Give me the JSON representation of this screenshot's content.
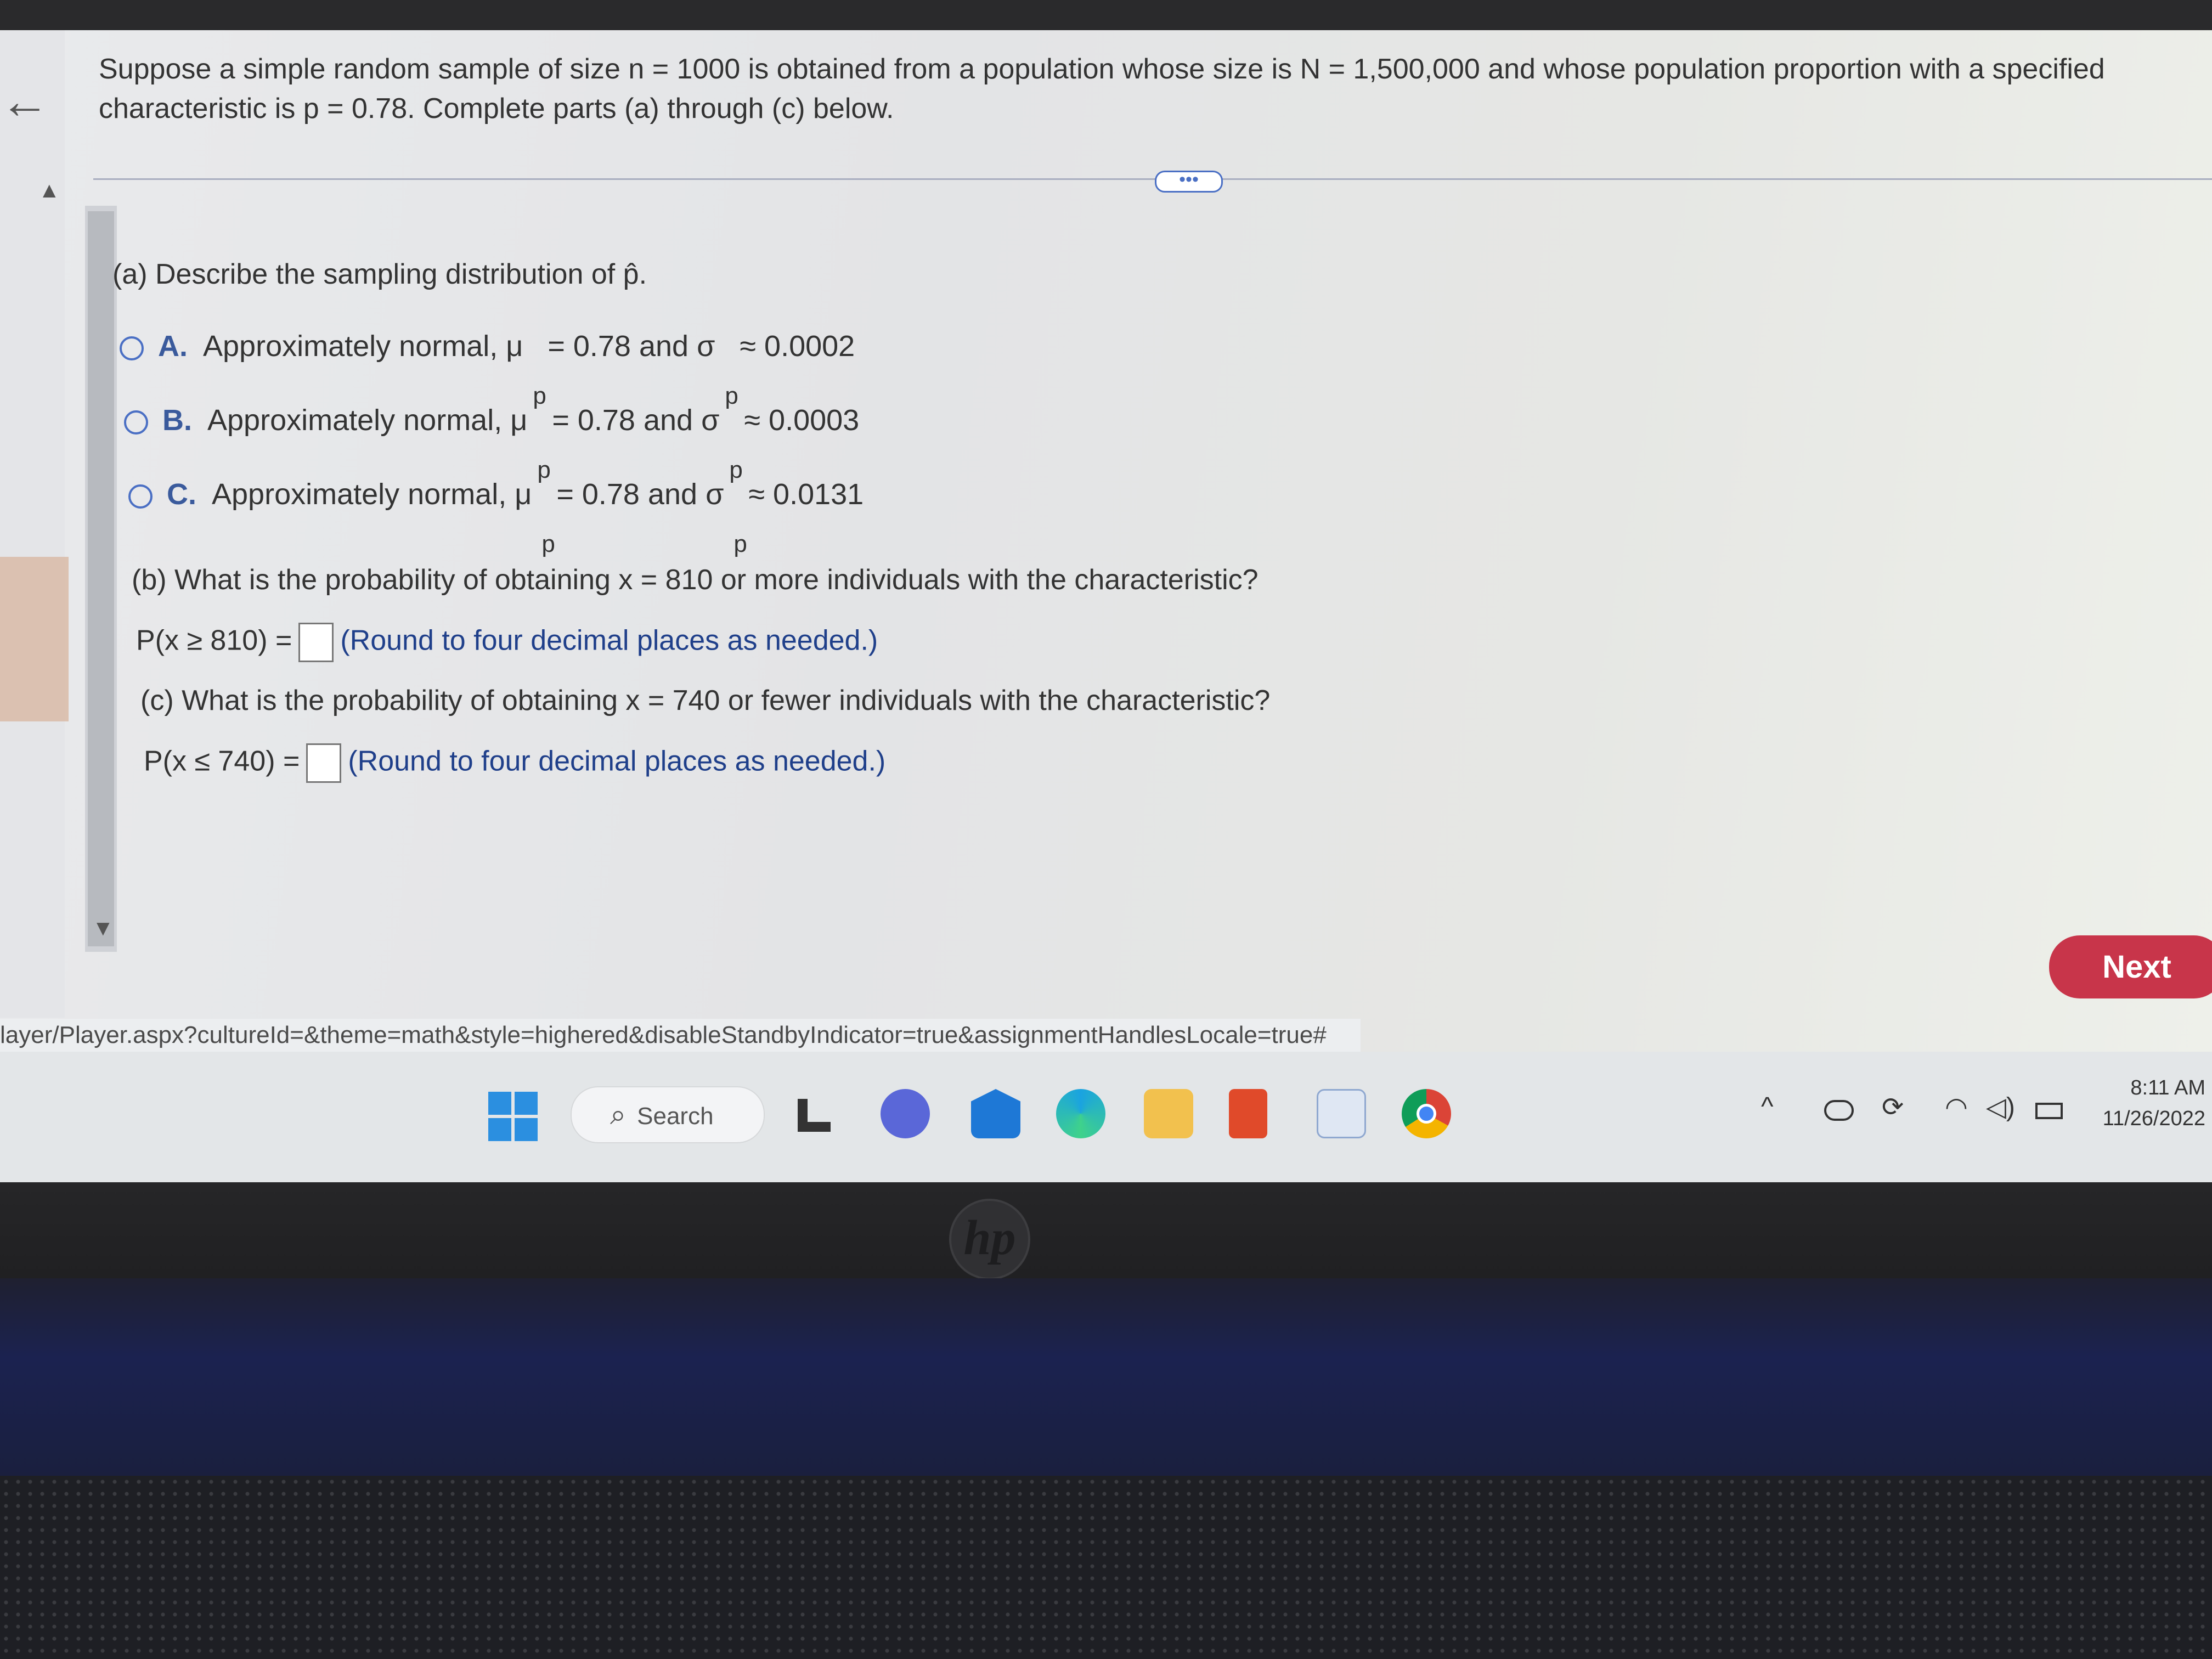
{
  "question": {
    "intro": "Suppose a simple random sample of size n = 1000 is obtained from a population whose size is N = 1,500,000 and whose population proportion with a specified characteristic is p = 0.78. Complete parts (a) through (c) below."
  },
  "more_label": "•••",
  "part_a": {
    "prompt": "(a) Describe the sampling distribution of p̂.",
    "options": [
      {
        "letter": "A.",
        "text_pre": "Approximately normal, μ",
        "mu_val": " = 0.78 and σ",
        "sigma_val": " ≈ 0.0002"
      },
      {
        "letter": "B.",
        "text_pre": "Approximately normal, μ",
        "mu_val": " = 0.78 and σ",
        "sigma_val": " ≈ 0.0003"
      },
      {
        "letter": "C.",
        "text_pre": "Approximately normal, μ",
        "mu_val": " = 0.78 and σ",
        "sigma_val": " ≈ 0.0131"
      }
    ],
    "subscript": "p"
  },
  "part_b": {
    "prompt": "(b) What is the probability of obtaining x = 810 or more individuals with the characteristic?",
    "answer_label": "P(x ≥ 810) =",
    "answer_value": "",
    "hint": "(Round to four decimal places as needed.)"
  },
  "part_c": {
    "prompt": "(c) What is the probability of obtaining x = 740 or fewer individuals with the characteristic?",
    "answer_label": "P(x ≤ 740) =",
    "answer_value": "",
    "hint": "(Round to four decimal places as needed.)"
  },
  "next_label": "Next",
  "url": "layer/Player.aspx?cultureId=&theme=math&style=highered&disableStandbyIndicator=true&assignmentHandlesLocale=true#",
  "taskbar": {
    "search_label": "Search",
    "time": "8:11 AM",
    "date": "11/26/2022"
  },
  "hp_logo": "hp"
}
